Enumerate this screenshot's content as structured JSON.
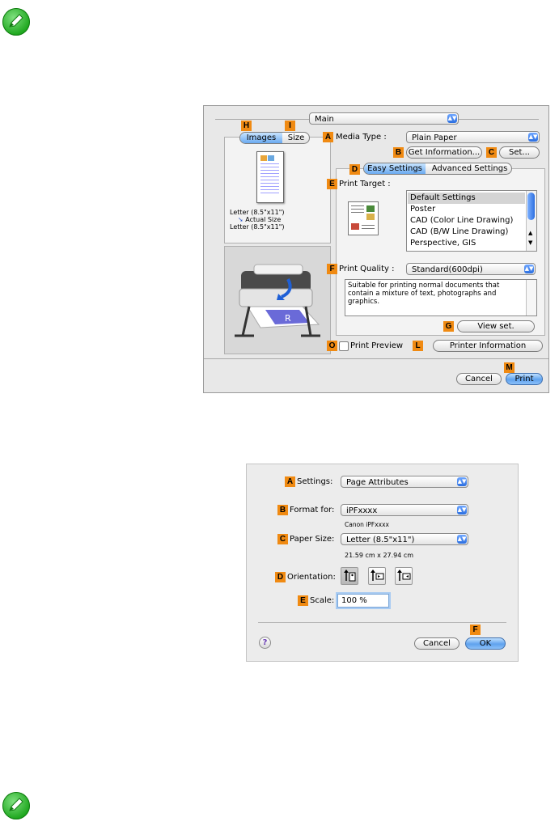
{
  "print_dialog": {
    "tab_selector": "Main",
    "preview_tabs": [
      "Images",
      "Size"
    ],
    "paper_summary": [
      "Letter (8.5\"x11\")",
      "Actual Size",
      "Letter (8.5\"x11\")"
    ],
    "media_type_label": "Media Type :",
    "media_type_value": "Plain Paper",
    "get_information": "Get Information...",
    "set": "Set...",
    "settings_tabs": [
      "Easy Settings",
      "Advanced Settings"
    ],
    "print_target_label": "Print Target :",
    "print_targets": [
      "Default Settings",
      "Poster",
      "CAD (Color Line Drawing)",
      "CAD (B/W Line Drawing)",
      "Perspective, GIS"
    ],
    "print_quality_label": "Print Quality :",
    "print_quality_value": "Standard(600dpi)",
    "description": "Suitable for printing normal documents that contain a mixture of text, photographs and graphics.",
    "view_set": "View set.",
    "print_preview": "Print Preview",
    "printer_information": "Printer Information",
    "cancel": "Cancel",
    "print": "Print"
  },
  "page_setup": {
    "settings_label": "Settings:",
    "settings_value": "Page Attributes",
    "format_for_label": "Format for:",
    "format_for_value": "iPFxxxx",
    "format_sub": "Canon iPFxxxx",
    "paper_size_label": "Paper Size:",
    "paper_size_value": "Letter (8.5\"x11\")",
    "paper_dims": "21.59 cm x 27.94 cm",
    "orientation_label": "Orientation:",
    "scale_label": "Scale:",
    "scale_value": "100 %",
    "help": "?",
    "cancel": "Cancel",
    "ok": "OK"
  },
  "markers": {
    "A": "A",
    "B": "B",
    "C": "C",
    "D": "D",
    "E": "E",
    "F": "F",
    "G": "G",
    "H": "H",
    "I": "I",
    "L": "L",
    "M": "M",
    "O": "O"
  },
  "colors": {
    "note_green": "#1ea71e",
    "marker_orange": "#f08a12",
    "aqua_blue": "#5fa2ee"
  }
}
